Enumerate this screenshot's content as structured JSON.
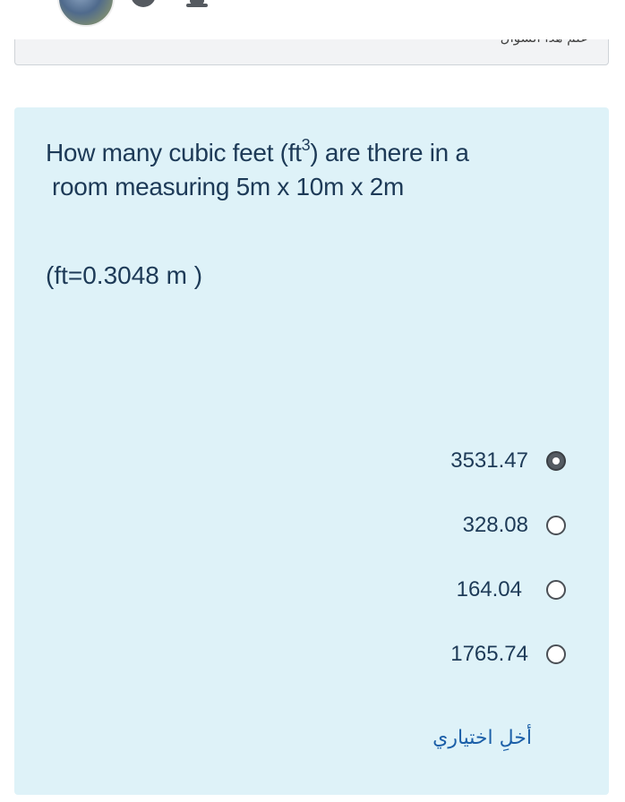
{
  "header": {
    "avatar_icon": "user-avatar",
    "chat_icon": "chat-bubble-icon",
    "bell_icon": "bell-icon"
  },
  "info": {
    "flag_text": "علم هذا السؤال"
  },
  "question": {
    "line1_prefix": "How many cubic feet (ft",
    "line1_sup": "3",
    "line1_suffix": ") are there in a",
    "line2": "room measuring 5m x 10m x 2m",
    "note": "(ft=0.3048 m )"
  },
  "options": [
    {
      "label": "3531.47",
      "selected": true
    },
    {
      "label": "328.08",
      "selected": false
    },
    {
      "label": "164.04",
      "selected": false
    },
    {
      "label": "1765.74",
      "selected": false
    }
  ],
  "clear_choice": "أخلِ اختياري",
  "colors": {
    "question_bg": "#def2f8",
    "text": "#1d3a57",
    "link": "#1b5fa8"
  }
}
